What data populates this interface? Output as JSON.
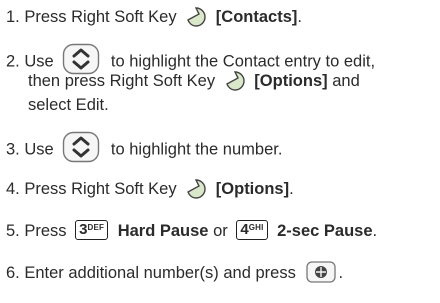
{
  "steps": [
    {
      "num": "1.",
      "pre": "Press Right Soft Key",
      "bold": "[Contacts]",
      "post": "."
    },
    {
      "num": "2.",
      "use": "Use",
      "line1": "to highlight the Contact entry to edit,",
      "line2a": "then press Right Soft Key",
      "line2b": "[Options]",
      "line2c": "and",
      "line3": "select Edit."
    },
    {
      "num": "3.",
      "use": "Use",
      "rest": "to highlight the number."
    },
    {
      "num": "4.",
      "pre": "Press Right Soft Key",
      "bold": "[Options]",
      "post": "."
    },
    {
      "num": "5.",
      "pre": "Press",
      "key1_big": "3",
      "key1_small": "DEF",
      "hard": "Hard Pause",
      "or": "or",
      "key2_big": "4",
      "key2_small": "GHI",
      "twosec": "2-sec Pause",
      "post": "."
    },
    {
      "num": "6.",
      "pre": "Enter additional number(s) and press",
      "post": "."
    }
  ],
  "icons": {
    "softkey": "right-soft-key-icon",
    "nav": "navigation-key-icon",
    "ok": "ok-key-icon"
  }
}
